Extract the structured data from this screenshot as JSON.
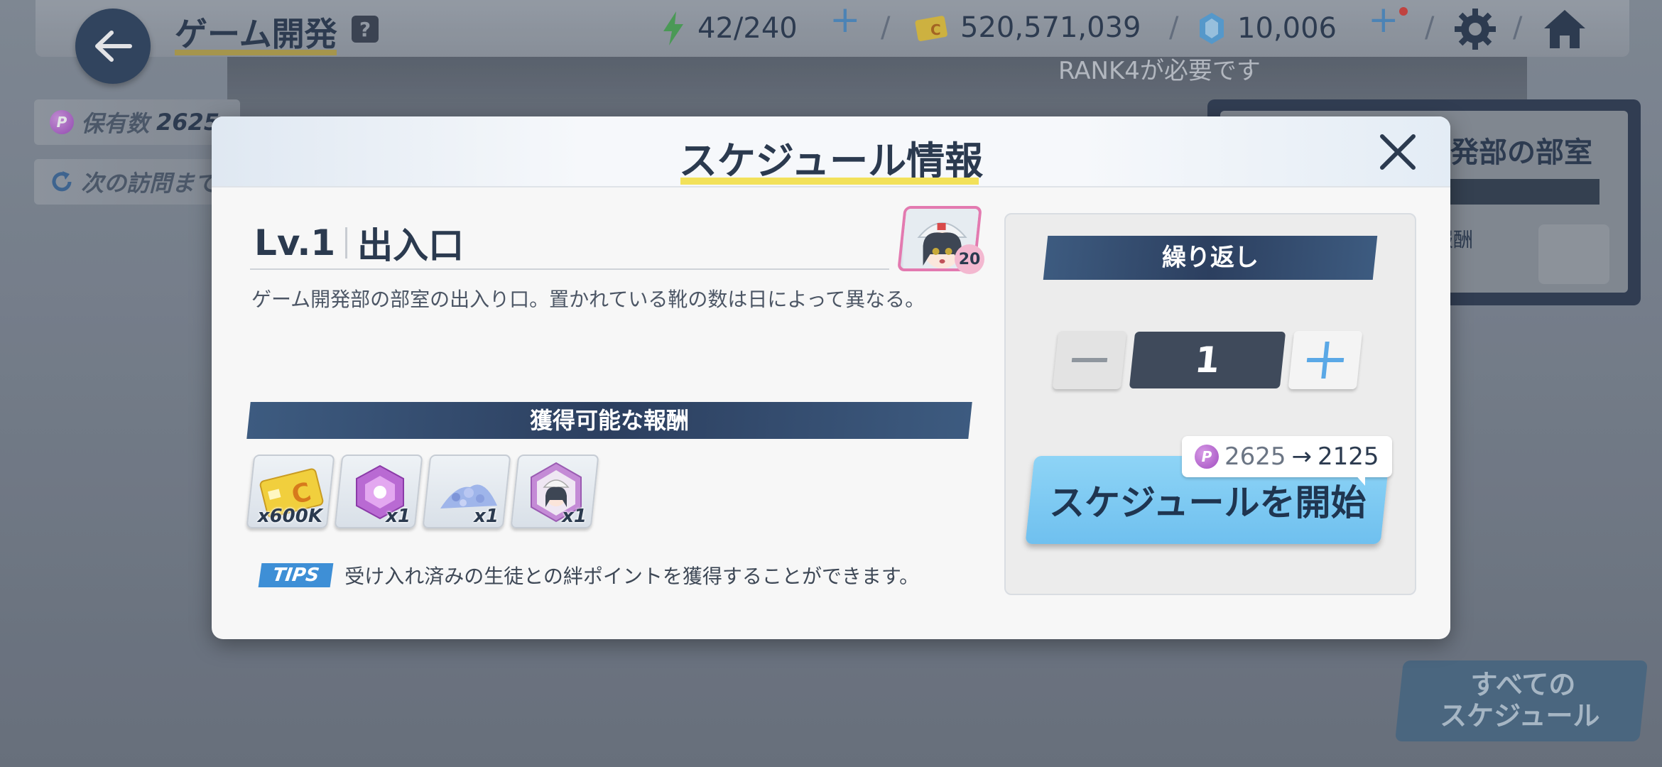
{
  "topbar": {
    "title": "ゲーム開発",
    "help_label": "?",
    "energy": "42/240",
    "credits": "520,571,039",
    "gems": "10,006"
  },
  "left_chips": {
    "owned_label": "保有数",
    "owned_value": "2625",
    "next_visit_label": "次の訪問まで"
  },
  "background": {
    "rank_notice": "RANK4が必要です",
    "side_panel_title": "発部の部室",
    "side_panel_reward": "報酬"
  },
  "all_schedules_button": [
    "すべての",
    "スケジュール"
  ],
  "modal": {
    "title": "スケジュール情報",
    "level": "Lv.1",
    "location": "出入口",
    "student_level": "20",
    "description": "ゲーム開発部の部室の出入り口。置かれている靴の数は日によって異なる。",
    "rewards_header": "獲得可能な報酬",
    "rewards": [
      {
        "icon": "credit-card-icon",
        "count": "x600K"
      },
      {
        "icon": "purple-gem-icon",
        "count": "x1"
      },
      {
        "icon": "blue-crystals-icon",
        "count": "x1"
      },
      {
        "icon": "student-portrait-icon",
        "count": "x1"
      }
    ],
    "tips_badge": "TIPS",
    "tips_text": "受け入れ済みの生徒との絆ポイントを獲得することができます。",
    "repeat_header": "繰り返し",
    "repeat_count": "1",
    "cost_from": "2625",
    "cost_arrow": "→",
    "cost_to": "2125",
    "start_button": "スケジュールを開始"
  },
  "colors": {
    "navy": "#2c3f5f",
    "accent_yellow": "#f2e15a",
    "start_blue": "#7ecaf2",
    "tips_blue": "#3e8fd6"
  }
}
